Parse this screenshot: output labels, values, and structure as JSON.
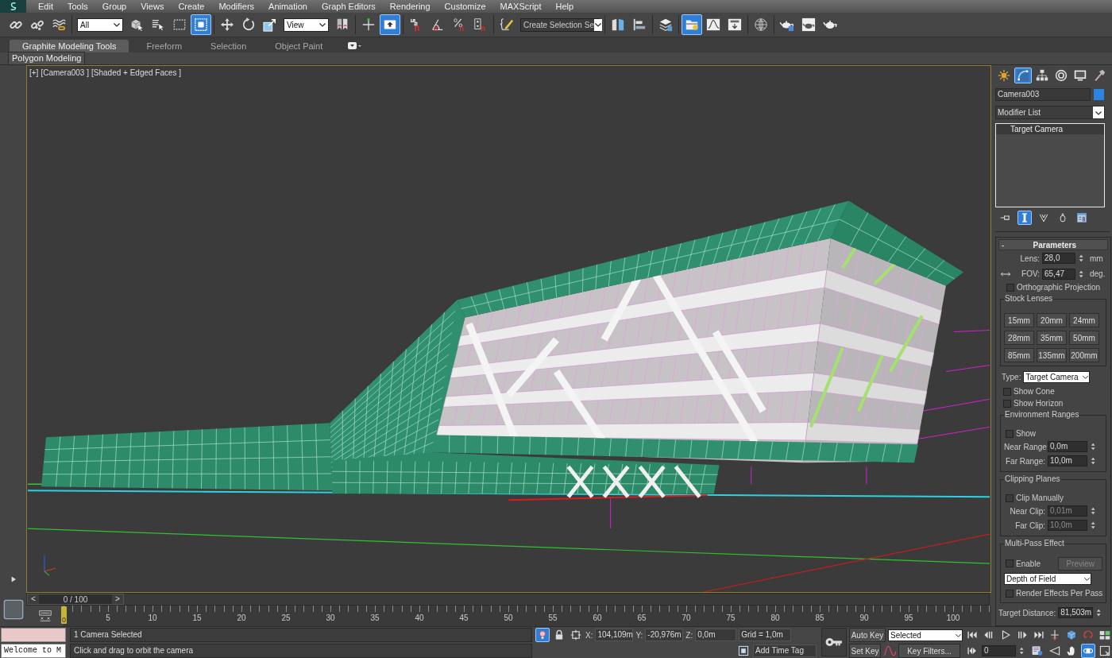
{
  "menu": [
    "Edit",
    "Tools",
    "Group",
    "Views",
    "Create",
    "Modifiers",
    "Animation",
    "Graph Editors",
    "Rendering",
    "Customize",
    "MAXScript",
    "Help"
  ],
  "toolbar": {
    "groups": [
      [
        {
          "kind": "icon",
          "selected": false
        },
        {
          "kind": "icon",
          "selected": false
        },
        {
          "kind": "icon",
          "selected": false
        }
      ],
      [
        {
          "kind": "dropdown",
          "value": "All"
        },
        {
          "kind": "icon",
          "selected": false
        },
        {
          "kind": "icon",
          "selected": false
        },
        {
          "kind": "icon",
          "selected": false
        },
        {
          "kind": "icon",
          "selected": true
        }
      ],
      [
        {
          "kind": "icon",
          "selected": false
        },
        {
          "kind": "icon",
          "selected": false
        },
        {
          "kind": "icon",
          "selected": false
        },
        {
          "kind": "dropdown",
          "value": "View"
        },
        {
          "kind": "icon",
          "selected": false
        }
      ],
      [
        {
          "kind": "icon",
          "selected": false
        },
        {
          "kind": "icon",
          "selected": true
        }
      ],
      [
        {
          "kind": "icon",
          "selected": false
        },
        {
          "kind": "icon",
          "selected": false
        },
        {
          "kind": "icon",
          "selected": false
        },
        {
          "kind": "icon",
          "selected": false
        }
      ],
      [
        {
          "kind": "icon",
          "selected": false
        },
        {
          "kind": "combo",
          "value": "Create Selection Se"
        }
      ],
      [
        {
          "kind": "icon",
          "selected": false
        },
        {
          "kind": "icon",
          "selected": false
        }
      ],
      [
        {
          "kind": "icon",
          "selected": false
        }
      ],
      [
        {
          "kind": "icon",
          "selected": true
        },
        {
          "kind": "icon",
          "selected": false
        },
        {
          "kind": "icon",
          "selected": false
        }
      ],
      [
        {
          "kind": "icon",
          "selected": false
        }
      ],
      [
        {
          "kind": "icon",
          "selected": false
        },
        {
          "kind": "icon",
          "selected": false
        },
        {
          "kind": "icon",
          "selected": false
        }
      ]
    ]
  },
  "ribbon": {
    "tabs": [
      {
        "label": "Graphite Modeling Tools",
        "selected": true
      },
      {
        "label": "Freeform",
        "selected": false
      },
      {
        "label": "Selection",
        "selected": false
      },
      {
        "label": "Object Paint",
        "selected": false
      }
    ],
    "panel": "Polygon Modeling"
  },
  "viewport": {
    "labels": [
      "[+]",
      "[Camera003 ]",
      "[Shaded + Edged Faces ]"
    ]
  },
  "command_panel": {
    "tabs": [
      {
        "selected": false
      },
      {
        "selected": true
      },
      {
        "selected": false
      },
      {
        "selected": false
      },
      {
        "selected": false
      },
      {
        "selected": false
      }
    ],
    "object_name": "Camera003",
    "modifier_list": "Modifier List",
    "stack": [
      {
        "label": "Target Camera",
        "selected": false
      }
    ],
    "stack_tools": [
      {
        "selected": false
      },
      {
        "selected": true
      },
      {
        "selected": false
      },
      {
        "selected": false
      },
      {
        "selected": false
      }
    ],
    "rollout": {
      "collapse": "-",
      "title": "Parameters",
      "lens": {
        "label": "Lens:",
        "value": "28,0",
        "unit": "mm"
      },
      "fov": {
        "label": "FOV:",
        "value": "65,47",
        "unit": "deg."
      },
      "orthographic": {
        "label": "Orthographic Projection",
        "checked": false
      },
      "stock_lenses": {
        "title": "Stock Lenses",
        "buttons": [
          "15mm",
          "20mm",
          "24mm",
          "28mm",
          "35mm",
          "50mm",
          "85mm",
          "135mm",
          "200mm"
        ]
      },
      "type": {
        "label": "Type:",
        "value": "Target Camera"
      },
      "show_cone": {
        "label": "Show Cone",
        "checked": false
      },
      "show_horizon": {
        "label": "Show Horizon",
        "checked": false
      },
      "environment_ranges": {
        "title": "Environment Ranges",
        "show": {
          "label": "Show",
          "checked": false
        },
        "near": {
          "label": "Near Range:",
          "value": "0,0m",
          "disabled": false
        },
        "far": {
          "label": "Far Range:",
          "value": "10,0m",
          "disabled": false
        }
      },
      "clipping_planes": {
        "title": "Clipping Planes",
        "clip": {
          "label": "Clip Manually",
          "checked": false
        },
        "near": {
          "label": "Near Clip:",
          "value": "0,01m",
          "disabled": true
        },
        "far": {
          "label": "Far Clip:",
          "value": "10,0m",
          "disabled": true
        }
      },
      "multi_pass": {
        "title": "Multi-Pass Effect",
        "enable": {
          "label": "Enable",
          "checked": false
        },
        "preview": {
          "label": "Preview",
          "disabled": true
        },
        "effect": "Depth of Field",
        "per_pass": {
          "label": "Render Effects Per Pass",
          "checked": false
        }
      },
      "target_distance": {
        "label": "Target Distance:",
        "value": "81,503m"
      }
    }
  },
  "time_slider": {
    "prev": "<",
    "label": "0 / 100",
    "next": ">",
    "level": 0
  },
  "track_bar": {
    "current_frame": "0",
    "frame_labels": [
      "5",
      "10",
      "15",
      "20",
      "25",
      "30",
      "35",
      "40",
      "45",
      "50",
      "55",
      "60",
      "65",
      "70",
      "75",
      "80",
      "85",
      "90",
      "95",
      "100"
    ]
  },
  "status": {
    "listener_output": "Welcome to M",
    "prompt": "1 Camera Selected",
    "hint": "Click and drag to orbit the camera",
    "tools": [
      {
        "selected": true
      },
      {
        "selected": false
      },
      {
        "selected": false
      }
    ],
    "coords": [
      {
        "axis": "X:",
        "value": "104,109m"
      },
      {
        "axis": "Y:",
        "value": "-20,976m"
      },
      {
        "axis": "Z:",
        "value": "0,0m"
      }
    ],
    "grid": "Grid = 1,0m",
    "time_tag": "Add Time Tag",
    "auto_key": {
      "label": "Auto Key",
      "on": false
    },
    "set_key": "Set Key",
    "key_set": "Selected",
    "key_filters": "Key Filters...",
    "frame": "0",
    "nav": [
      {
        "selected": false
      },
      {
        "selected": false
      },
      {
        "selected": false
      },
      {
        "selected": false
      },
      {
        "selected": false
      },
      {
        "selected": false
      },
      {
        "selected": true
      },
      {
        "selected": false
      }
    ]
  }
}
